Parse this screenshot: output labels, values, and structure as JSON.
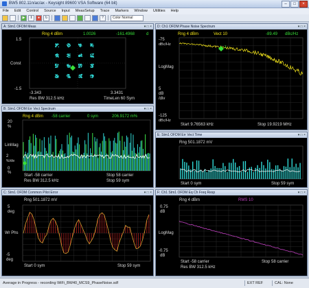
{
  "app": {
    "title": "BW5 802.11n/ac/ax - Keysight 89600 VSA Software (64 bit)",
    "menu": [
      "File",
      "Edit",
      "Control",
      "Source",
      "Input",
      "MeasSetup",
      "Trace",
      "Markers",
      "Window",
      "Utilities",
      "Help"
    ],
    "toolbar_select": "Color Normal"
  },
  "pane_a": {
    "title": "A: Stm1 OFDM Meas",
    "rng": "Rng 4 dBm",
    "marker_x": "1.0026",
    "marker_y": "-161.4968",
    "marker_unit": "d",
    "y_top": "1.5",
    "y_label": "Const",
    "y_bottom": "-1.5",
    "x_left": "-3.343",
    "x_right": "3.3431",
    "footer_left": "Res BW 312.5 kHz",
    "footer_right": "TimeLen 60  Sym"
  },
  "pane_b": {
    "title": "B: Stm1 OFDM Err Vect Spectrum",
    "rng": "Rng 4 dBm",
    "marker": "-58 carrier",
    "marker2": "0 sym",
    "marker_val": "206.9172 m%",
    "y_top": "20",
    "y_top_unit": "%",
    "y_label": "LinMag",
    "y_mid": "2",
    "y_mid_unit": "%/div",
    "y_bottom": "0",
    "y_bottom_unit": "%",
    "start": "Start -58  carrier",
    "stop": "Stop 58  carrier",
    "res": "Res BW 312.5 kHz",
    "stop2": "Stop 59  sym"
  },
  "pane_c": {
    "title": "C: Stm1 OFDM Common Pilot Error",
    "rng": "Rng 501.1872 mV",
    "y_top": "5",
    "y_top_unit": "deg",
    "y_label": "Wr Phs",
    "y_bottom": "-5",
    "y_bottom_unit": "deg",
    "start": "Start 0  sym",
    "stop": "Stop 59  sym"
  },
  "pane_d": {
    "title": "D: Ch1 OFDM Phase Noise Spectrum",
    "rng": "Rng 4 dBm",
    "marker": "Vect 10",
    "marker_val": "-89.49",
    "marker_unit": "dBc/Hz",
    "y_top": "-75",
    "y_top_unit": "dBc/Hz",
    "y_label": "LogMag",
    "y_mid": "5",
    "y_mid_unit": "dB",
    "y_mid_unit2": "/div",
    "y_bottom": "-125",
    "y_bottom_unit": "dBc/Hz",
    "start": "Start 9.76563 kHz",
    "stop": "Stop 19.9219 MHz"
  },
  "pane_e": {
    "title": "E: Stm1 OFDM Err Vect Time",
    "rng": "Rng 501.1872 mV",
    "start": "Start 0  sym",
    "stop": "Stop 59  sym"
  },
  "pane_f": {
    "title": "F: Ch1 Stm1 OFDM Eq Ch Freq Resp",
    "rng": "Rng 4 dBm",
    "marker": "RMS 10",
    "y_top": "0.75",
    "y_top_unit": "dB",
    "y_label": "LogMag",
    "y_bottom": "-0.75",
    "y_bottom_unit": "dB",
    "start": "Start -58  carrier",
    "stop": "Stop 58  carrier",
    "res": "Res BW 312.5 kHz"
  },
  "status": {
    "left": "Average in Progress - recording WiFi_BW40_MCS9_PhaseNoise.sdf",
    "ext": "EXT REF",
    "cal": "CAL: None"
  },
  "colors": {
    "trace_yellow": "#f5e61a",
    "trace_cyan": "#30d9d6",
    "trace_green": "#3ee84a",
    "trace_purple": "#c040c0",
    "trace_orange": "#d8a030",
    "trace_red": "#c02020",
    "marker_green": "#38e038"
  }
}
